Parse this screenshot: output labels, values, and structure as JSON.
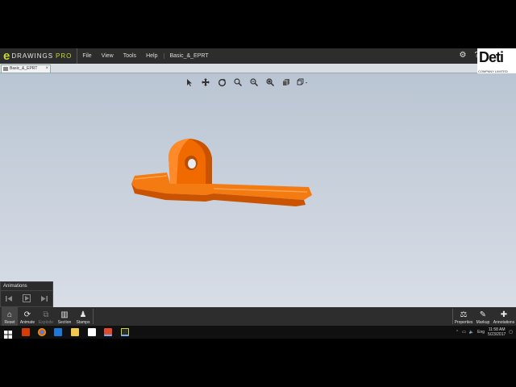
{
  "app": {
    "logo_e": "e",
    "logo_text": "DRAWINGS",
    "logo_pro": "PRO",
    "menu": [
      "File",
      "View",
      "Tools",
      "Help"
    ],
    "document_title": "Basic_&_EPRT",
    "brand": "Deti",
    "brand_sub": "COMPANY LIMITED"
  },
  "tabs": [
    {
      "label": "Basic_&_EPRT",
      "close": "×"
    }
  ],
  "view_toolbar": [
    "select-arrow-icon",
    "pan-icon",
    "rotate-icon",
    "zoom-to-fit-icon",
    "zoom-in-icon",
    "zoom-area-icon",
    "view-orientation-icon",
    "display-style-icon"
  ],
  "animations_panel": {
    "title": "Animations",
    "controls": [
      "previous-icon",
      "play-icon",
      "next-icon"
    ]
  },
  "bottom_toolbar": {
    "left": [
      {
        "label": "Reset",
        "icon": "⌂",
        "enabled": true
      },
      {
        "label": "Animate",
        "icon": "⟳",
        "enabled": true
      },
      {
        "label": "Explode",
        "icon": "⧉",
        "enabled": false
      },
      {
        "label": "Section",
        "icon": "▥",
        "enabled": true
      },
      {
        "label": "Stamps",
        "icon": "♟",
        "enabled": true
      }
    ],
    "right": [
      {
        "label": "Properties",
        "icon": "⚖",
        "enabled": true
      },
      {
        "label": "Markup",
        "icon": "✎",
        "enabled": true
      },
      {
        "label": "Annotations",
        "icon": "✚",
        "enabled": true
      }
    ]
  },
  "taskbar": {
    "tray_lang": "Eng",
    "time": "11:58 AM",
    "date": "5/23/2017"
  },
  "colors": {
    "part": "#f06a00",
    "part_shadow": "#b84d00",
    "viewport_top": "#bac5d3",
    "logo_accent": "#c7d82f"
  }
}
